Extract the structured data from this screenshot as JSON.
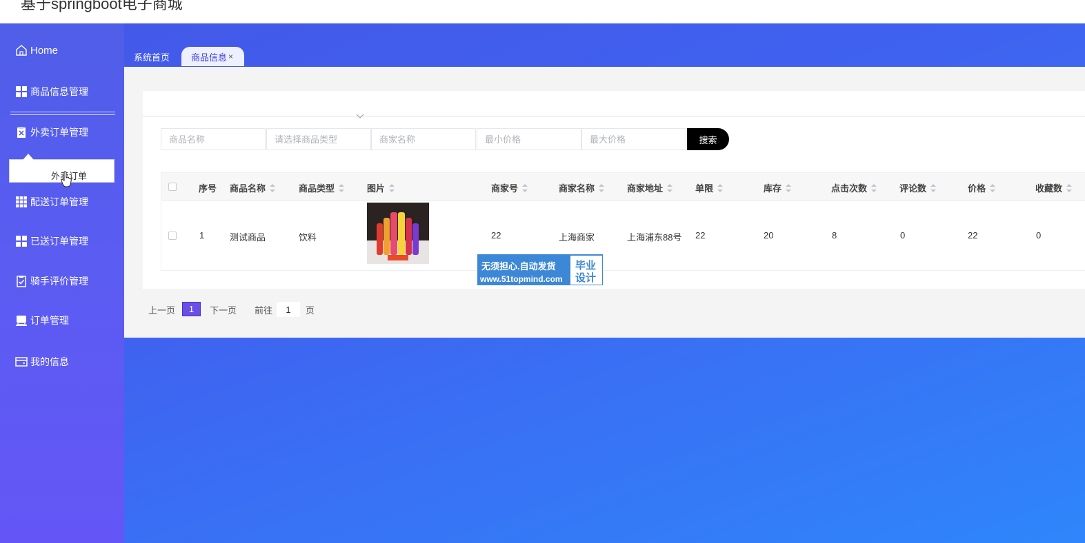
{
  "app": {
    "title": "基于springboot电子商城"
  },
  "sidebar": {
    "home_label": "Home",
    "items": [
      {
        "label": "商品信息管理",
        "icon": "grid-icon"
      },
      {
        "label": "外卖订单管理",
        "icon": "clipboard-x-icon"
      },
      {
        "label": "配送订单管理",
        "icon": "grid-9-icon"
      },
      {
        "label": "已送订单管理",
        "icon": "grid-icon"
      },
      {
        "label": "骑手评价管理",
        "icon": "clipboard-check-icon"
      },
      {
        "label": "订单管理",
        "icon": "printer-icon"
      },
      {
        "label": "我的信息",
        "icon": "card-icon"
      }
    ],
    "submenu": {
      "label": "外卖订单"
    }
  },
  "tabs": [
    {
      "label": "系统首页",
      "active": false
    },
    {
      "label": "商品信息",
      "active": true,
      "close": "×"
    }
  ],
  "search": {
    "name_placeholder": "商品名称",
    "type_placeholder": "请选择商品类型",
    "merchant_placeholder": "商家名称",
    "min_price_placeholder": "最小价格",
    "max_price_placeholder": "最大价格",
    "button_label": "搜索"
  },
  "table": {
    "columns": [
      "序号",
      "商品名称",
      "商品类型",
      "图片",
      "商家号",
      "商家名称",
      "商家地址",
      "单限",
      "库存",
      "点击次数",
      "评论数",
      "价格",
      "收藏数"
    ],
    "rows": [
      {
        "index": "1",
        "name": "测试商品",
        "type": "饮料",
        "merchant_no": "22",
        "merchant_name": "上海商家",
        "address": "上海浦东88号",
        "limit": "22",
        "stock": "20",
        "clicks": "8",
        "comments": "0",
        "price": "22",
        "favorites": "0"
      }
    ]
  },
  "watermark": {
    "line1": "无须担心.自动发货",
    "line2": "www.51topmind.com",
    "badge_top": "毕业",
    "badge_bottom": "设计"
  },
  "pagination": {
    "prev_label": "上一页",
    "current_page": "1",
    "next_label": "下一页",
    "goto_label": "前往",
    "goto_value": "1",
    "page_suffix": "页"
  },
  "colors": {
    "sidebar": "#5a5cf2",
    "main_gradient_start": "#4457e8",
    "main_gradient_end": "#2f86fb",
    "accent": "#6b4ee6",
    "search_button": "#000000"
  }
}
